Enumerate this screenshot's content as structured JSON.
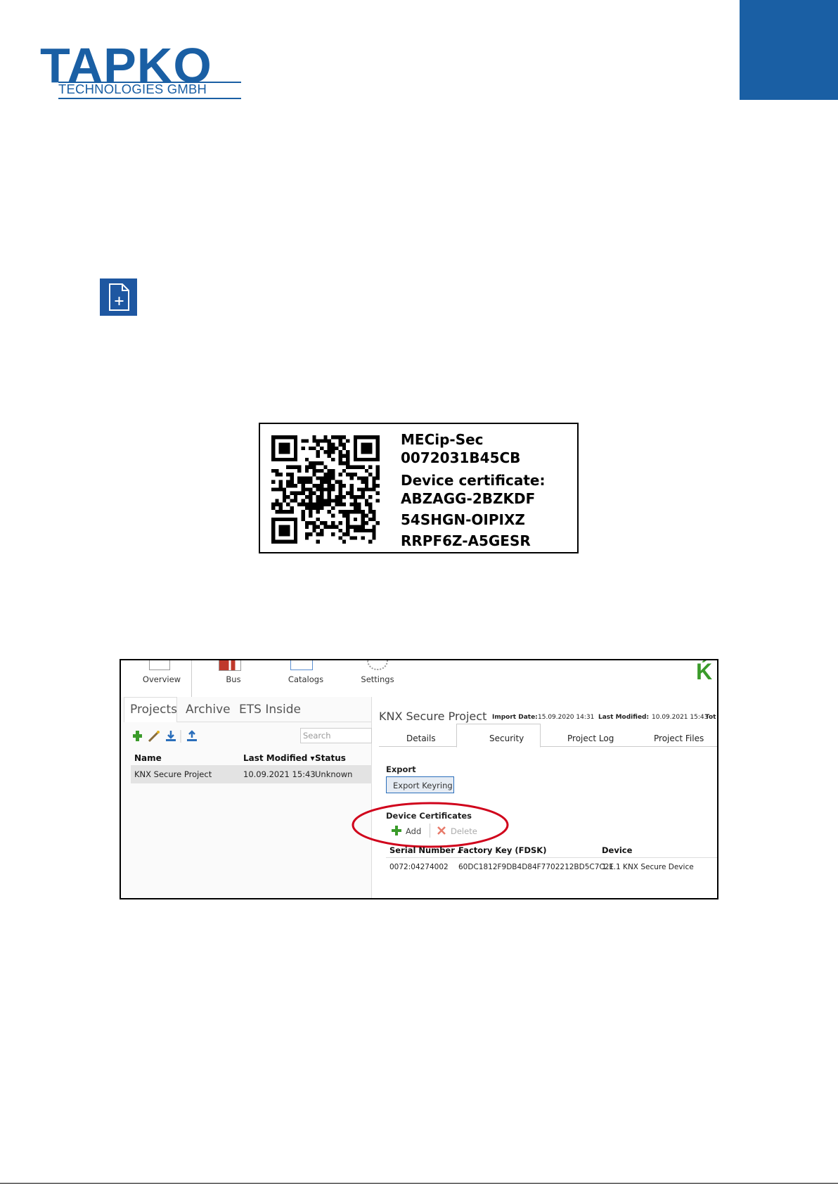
{
  "header": {
    "logo_main": "TAPKO",
    "logo_sub": "TECHNOLOGIES GMBH"
  },
  "icons": {
    "new_file": "file-plus-icon"
  },
  "device_label": {
    "product": "MECip-Sec",
    "serial": "0072031B45CB",
    "certificate_title": "Device certificate:",
    "cert_line1": "ABZAGG-2BZKDF",
    "cert_line2": "54SHGN-OIPIXZ",
    "cert_line3": "RRPF6Z-A5GESR"
  },
  "ets": {
    "ribbon": {
      "overview": "Overview",
      "bus": "Bus",
      "catalogs": "Catalogs",
      "settings": "Settings"
    },
    "left_tabs": {
      "projects": "Projects",
      "archive": "Archive",
      "ets_inside": "ETS Inside"
    },
    "search_placeholder": "Search",
    "columns": {
      "name": "Name",
      "last_modified": "Last Modified ▾",
      "status": "Status"
    },
    "project_row": {
      "name": "KNX Secure Project",
      "last_modified": "10.09.2021 15:43",
      "status": "Unknown"
    },
    "project_title": "KNX Secure Project",
    "meta": {
      "import_label": "Import Date:",
      "import_value": "15.09.2020 14:31",
      "modified_label": "Last Modified:",
      "modified_value": "10.09.2021 15:43",
      "tot_label": "Tot"
    },
    "tabs": {
      "details": "Details",
      "security": "Security",
      "project_log": "Project Log",
      "project_files": "Project Files"
    },
    "export_heading": "Export",
    "export_button": "Export Keyring",
    "certs_heading": "Device Certificates",
    "add_label": "Add",
    "delete_label": "Delete",
    "cert_columns": {
      "serial": "Serial Number ▴",
      "fdsk": "Factory Key (FDSK)",
      "device": "Device"
    },
    "cert_row": {
      "serial": "0072:04274002",
      "fdsk": "60DC1812F9DB4D84F7702212BD5C7C2E",
      "device": "1.1.1 KNX Secure Device"
    },
    "colors": {
      "highlight_ring": "#d0021b",
      "accent_green": "#3a9b2a"
    }
  }
}
